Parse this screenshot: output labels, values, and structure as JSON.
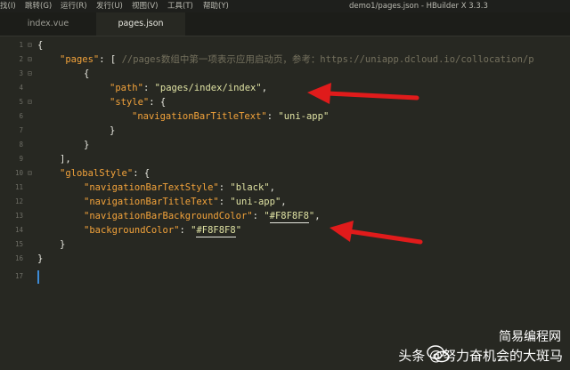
{
  "menubar": {
    "items": [
      "找(I)",
      "跳转(G)",
      "运行(R)",
      "发行(U)",
      "视图(V)",
      "工具(T)",
      "帮助(Y)"
    ],
    "window_title": "demo1/pages.json - HBuilder X 3.3.3"
  },
  "tabs": [
    {
      "label": "index.vue",
      "active": false
    },
    {
      "label": "pages.json",
      "active": true
    }
  ],
  "editor": {
    "line_numbers": [
      "1",
      "2",
      "3",
      "4",
      "5",
      "6",
      "7",
      "8",
      "9",
      "10",
      "11",
      "12",
      "13",
      "14",
      "15",
      "16",
      "17"
    ],
    "lines": {
      "l1": "{",
      "l2_key": "\"pages\"",
      "l2_rest": ": [ ",
      "l2_comment": "//pages数组中第一项表示应用启动页，参考：https://uniapp.dcloud.io/collocation/p",
      "l3": "{",
      "l4_key": "\"path\"",
      "l4_sep": ": ",
      "l4_val": "\"pages/index/index\"",
      "l4_end": ",",
      "l5_key": "\"style\"",
      "l5_rest": ": {",
      "l6_key": "\"navigationBarTitleText\"",
      "l6_sep": ": ",
      "l6_val": "\"uni-app\"",
      "l7": "}",
      "l8": "}",
      "l9": "],",
      "l10_key": "\"globalStyle\"",
      "l10_rest": ": {",
      "l11_key": "\"navigationBarTextStyle\"",
      "l11_sep": ": ",
      "l11_val": "\"black\"",
      "l11_end": ",",
      "l12_key": "\"navigationBarTitleText\"",
      "l12_sep": ": ",
      "l12_val": "\"uni-app\"",
      "l12_end": ",",
      "l13_key": "\"navigationBarBackgroundColor\"",
      "l13_sep": ": ",
      "l13_q1": "\"",
      "l13_val": "#F8F8F8",
      "l13_q2": "\"",
      "l13_end": ",",
      "l14_key": "\"backgroundColor\"",
      "l14_sep": ": ",
      "l14_q1": "\"",
      "l14_val": "#F8F8F8",
      "l14_q2": "\"",
      "l15": "}",
      "l16": "}"
    }
  },
  "watermark": {
    "source": "头条",
    "at_sign": "@",
    "name": "努力奋机会的大斑马",
    "channel": "简易编程网"
  },
  "colors": {
    "background": "#272822",
    "key": "#f3a33b",
    "string": "#dfe2a3",
    "comment": "#75715e",
    "arrow": "#e01b1b"
  }
}
